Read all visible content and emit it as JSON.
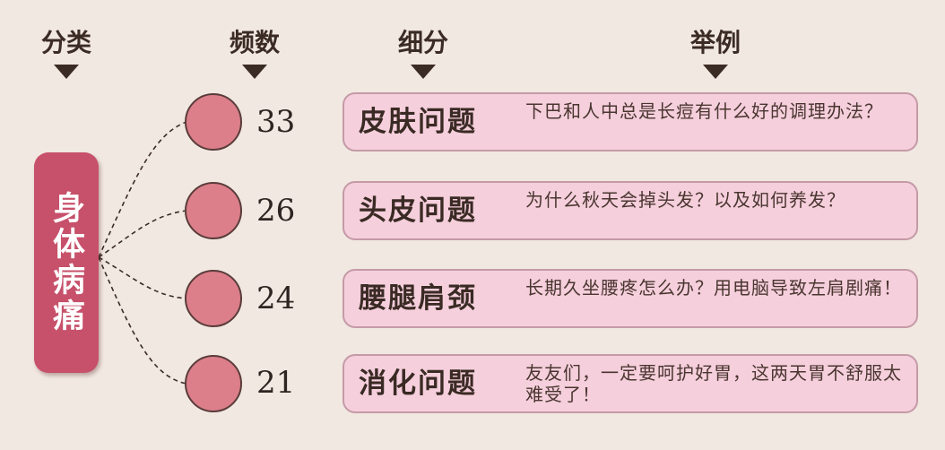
{
  "headers": {
    "category": "分类",
    "frequency": "频数",
    "subcategory": "细分",
    "example": "举例"
  },
  "main_category": "身体病痛",
  "rows": [
    {
      "frequency": "33",
      "name": "皮肤问题",
      "example": "下巴和人中总是长痘有什么好的调理办法？"
    },
    {
      "frequency": "26",
      "name": "头皮问题",
      "example": "为什么秋天会掉头发？以及如何养发？"
    },
    {
      "frequency": "24",
      "name": "腰腿肩颈",
      "example": "长期久坐腰疼怎么办？用电脑导致左肩剧痛！"
    },
    {
      "frequency": "21",
      "name": "消化问题",
      "example": "友友们，一定要呵护好胃，这两天胃不舒服太难受了！"
    }
  ],
  "colors": {
    "background": "#f1e8e1",
    "main_block": "#c7506a",
    "circle": "#dc7f8b",
    "pill": "#f5cfdc",
    "pill_border": "#c59aa7"
  }
}
